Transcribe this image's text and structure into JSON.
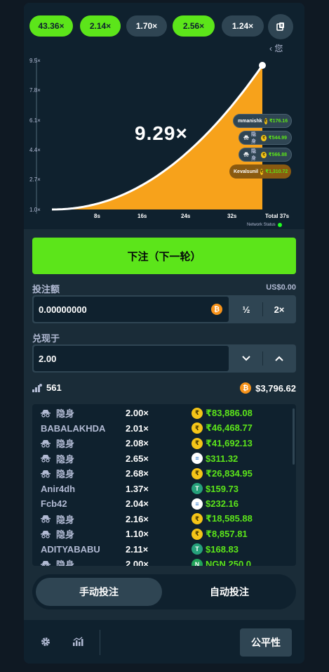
{
  "history": [
    {
      "label": "43.36×",
      "color": "green"
    },
    {
      "label": "2.14×",
      "color": "green"
    },
    {
      "label": "1.70×",
      "color": "gray"
    },
    {
      "label": "2.56×",
      "color": "green"
    },
    {
      "label": "1.24×",
      "color": "gray"
    }
  ],
  "history_icon": "history-icon",
  "you_label": "‹ 您",
  "chart_data": {
    "type": "line",
    "y_ticks": [
      "9.5×",
      "7.8×",
      "6.1×",
      "4.4×",
      "2.7×",
      "1.0×"
    ],
    "x_ticks": [
      "8s",
      "16s",
      "24s",
      "32s",
      "Total 37s"
    ],
    "current_multiplier": "9.29×",
    "fill_color": "#f7a21b",
    "line_color": "#ffffff"
  },
  "players_on_chart": [
    {
      "name": "mmanishk",
      "amount": "₹176.16",
      "style": "dark",
      "hidden": false
    },
    {
      "name": "",
      "amount": "₹544.99",
      "style": "dark",
      "hidden": true
    },
    {
      "name": "",
      "amount": "₹566.88",
      "style": "dark",
      "hidden": true
    },
    {
      "name": "Kevalsunil",
      "amount": "₹1,310.72",
      "style": "amber",
      "hidden": false
    }
  ],
  "network_status": "Network Status",
  "bet_button": "下注（下一轮）",
  "bet_amount": {
    "label": "投注额",
    "usd": "US$0.00",
    "value": "0.00000000",
    "half": "½",
    "double": "2×"
  },
  "cashout": {
    "label": "兑现于",
    "value": "2.00"
  },
  "stats": {
    "players": "561",
    "total": "$3,796.62"
  },
  "hidden_label": "隐身",
  "bets": [
    {
      "name": "",
      "hidden": true,
      "mult": "2.00×",
      "coin": "inr",
      "amount": "₹83,886.08"
    },
    {
      "name": "BABALAKHDA",
      "hidden": false,
      "mult": "2.01×",
      "coin": "inr",
      "amount": "₹46,468.77"
    },
    {
      "name": "",
      "hidden": true,
      "mult": "2.08×",
      "coin": "inr",
      "amount": "₹41,692.13"
    },
    {
      "name": "",
      "hidden": true,
      "mult": "2.65×",
      "coin": "usdc",
      "amount": "$311.32"
    },
    {
      "name": "",
      "hidden": true,
      "mult": "2.68×",
      "coin": "inr",
      "amount": "₹26,834.95"
    },
    {
      "name": "Anir4dh",
      "hidden": false,
      "mult": "1.37×",
      "coin": "usdt",
      "amount": "$159.73"
    },
    {
      "name": "Fcb42",
      "hidden": false,
      "mult": "2.04×",
      "coin": "usdc",
      "amount": "$232.16"
    },
    {
      "name": "",
      "hidden": true,
      "mult": "2.16×",
      "coin": "inr",
      "amount": "₹18,585.88"
    },
    {
      "name": "",
      "hidden": true,
      "mult": "1.10×",
      "coin": "inr",
      "amount": "₹8,857.81"
    },
    {
      "name": "ADITYABABU",
      "hidden": false,
      "mult": "2.11×",
      "coin": "usdt",
      "amount": "$168.83"
    },
    {
      "name": "",
      "hidden": true,
      "mult": "2.00×",
      "coin": "ngn",
      "amount": "NGN 250.0..."
    }
  ],
  "tabs": {
    "manual": "手动投注",
    "auto": "自动投注",
    "active": "manual"
  },
  "footer": {
    "settings_icon": "gear-icon",
    "stats_icon": "chart-icon",
    "fairness": "公平性"
  }
}
